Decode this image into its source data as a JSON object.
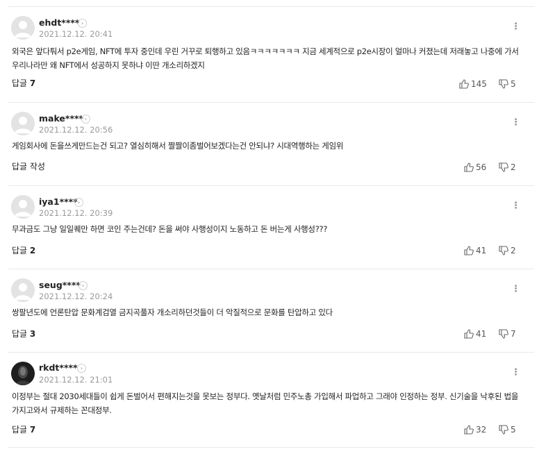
{
  "comments": [
    {
      "nickname": "ehdt****",
      "date": "2021.12.12. 20:41",
      "text": "외국은 앞다퉈서 p2e게임, NFT에 투자 중인데 우린 거꾸로 퇴행하고 있음ㅋㅋㅋㅋㅋㅋㅋ 지금 세계적으로 p2e시장이 얼마나 커졌는데 저래놓고 나중에 가서 우리나라만 왜 NFT에서 성공하지 못하냐 이딴 개소리하겠지",
      "reply_label": "답글",
      "reply_count": "7",
      "likes": "145",
      "dislikes": "5",
      "avatar": "default-profile"
    },
    {
      "nickname": "make****",
      "date": "2021.12.12. 20:56",
      "text": "게임회사에 돈을쓰게만드는건 되고? 열심히해서 짤짤이좀벌어보겠다는건 안되냐? 시대역행하는 게임위",
      "reply_label": "답글 작성",
      "reply_count": "",
      "likes": "56",
      "dislikes": "2",
      "avatar": "default-profile"
    },
    {
      "nickname": "iya1****",
      "date": "2021.12.12. 20:39",
      "text": "무과금도 그냥 일일퀘만 하면 코인 주는건데? 돈을 써야 사행성이지 노동하고 돈 버는게 사행성???",
      "reply_label": "답글",
      "reply_count": "2",
      "likes": "41",
      "dislikes": "2",
      "avatar": "default-profile"
    },
    {
      "nickname": "seug****",
      "date": "2021.12.12. 20:24",
      "text": "쌍팔년도에 언론탄압 문화계검열 금지곡풀자 개소리하던것들이 더 악질적으로 문화를 탄압하고 있다",
      "reply_label": "답글",
      "reply_count": "3",
      "likes": "41",
      "dislikes": "7",
      "avatar": "default-profile"
    },
    {
      "nickname": "rkdt****",
      "date": "2021.12.12. 21:01",
      "text": "이정부는 절대 2030세대들이 쉽게 돈벌어서 편해지는것을 못보는 정부다. 옛날처럼 민주노총 가입해서 파업하고 그래야 인정하는 정부. 신기술을 낙후된 법을 가지고와서 규제하는 꼰대정부.",
      "reply_label": "답글",
      "reply_count": "7",
      "likes": "32",
      "dislikes": "5",
      "avatar": "photo-profile"
    }
  ],
  "icons": {
    "profile_link": "chevron-right-icon",
    "more": "more-vertical-icon",
    "like": "thumbs-up-icon",
    "dislike": "thumbs-down-icon"
  },
  "colors": {
    "divider": "#e9e9e9",
    "meta_text": "#999999",
    "body_text": "#222222"
  }
}
